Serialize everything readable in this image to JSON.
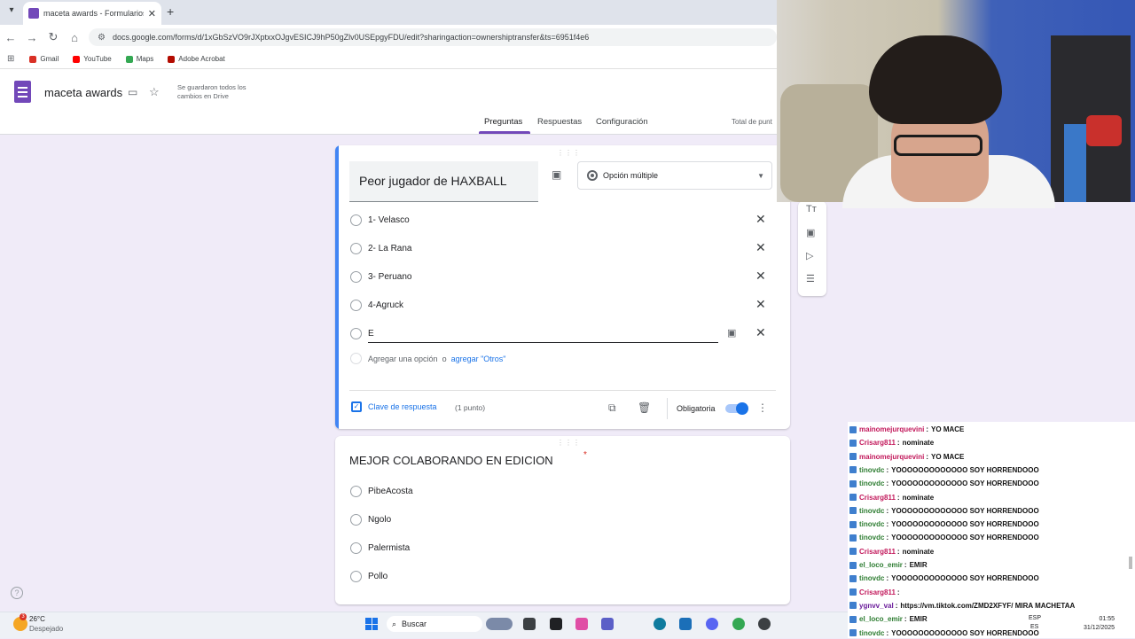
{
  "browser": {
    "tab_title": "maceta awards - Formularios d",
    "tab_close": "✕",
    "new_tab": "+",
    "url": "docs.google.com/forms/d/1xGbSzVO9rJXptxxOJgvESICJ9hP50gZlv0USEpgyFDU/edit?sharingaction=ownershiptransfer&ts=6951f4e6",
    "bookmarks": [
      "Gmail",
      "YouTube",
      "Maps",
      "Adobe Acrobat"
    ]
  },
  "form": {
    "title": "maceta awards",
    "saved_status": "Se guardaron todos los cambios en Drive",
    "tabs": [
      "Preguntas",
      "Respuestas",
      "Configuración"
    ],
    "total_points": "Total de punt"
  },
  "question1": {
    "title": "Peor jugador de HAXBALL",
    "type": "Opción múltiple",
    "options": [
      "1- Velasco",
      "2- La Rana",
      "3- Peruano",
      "4-Agruck",
      "E"
    ],
    "add_option": "Agregar una opción",
    "or": "o",
    "add_other": "agregar \"Otros\"",
    "answer_key": "Clave de respuesta",
    "points": "(1 punto)",
    "required_label": "Obligatoria"
  },
  "question2": {
    "title": "MEJOR COLABORANDO EN EDICION",
    "required_mark": "*",
    "options": [
      "PibeAcosta",
      "Ngolo",
      "Palermista",
      "Pollo"
    ]
  },
  "chat": [
    {
      "user": "mainomejurquevini",
      "text": "YO MACE",
      "color": "#c2185b"
    },
    {
      "user": "Crisarg811",
      "text": "nominate",
      "color": "#c2185b"
    },
    {
      "user": "mainomejurquevini",
      "text": "YO MACE",
      "color": "#c2185b"
    },
    {
      "user": "tinovdc",
      "text": "YOOOOOOOOOOOOO SOY HORRENDOOO",
      "color": "#2e7d32"
    },
    {
      "user": "tinovdc",
      "text": "YOOOOOOOOOOOOO SOY HORRENDOOO",
      "color": "#2e7d32"
    },
    {
      "user": "Crisarg811",
      "text": "nominate",
      "color": "#c2185b"
    },
    {
      "user": "tinovdc",
      "text": "YOOOOOOOOOOOOO SOY HORRENDOOO",
      "color": "#2e7d32"
    },
    {
      "user": "tinovdc",
      "text": "YOOOOOOOOOOOOO SOY HORRENDOOO",
      "color": "#2e7d32"
    },
    {
      "user": "tinovdc",
      "text": "YOOOOOOOOOOOOO SOY HORRENDOOO",
      "color": "#2e7d32"
    },
    {
      "user": "Crisarg811",
      "text": "nominate",
      "color": "#c2185b"
    },
    {
      "user": "el_loco_emir",
      "text": "EMIR",
      "color": "#2e7d32"
    },
    {
      "user": "tinovdc",
      "text": "YOOOOOOOOOOOOO SOY HORRENDOOO",
      "color": "#2e7d32"
    },
    {
      "user": "Crisarg811",
      "text": "",
      "color": "#c2185b"
    },
    {
      "user": "ygnvv_val",
      "text": "https://vm.tiktok.com/ZMD2XFYF/ MIRA MACHETAA",
      "color": "#6a1b9a"
    },
    {
      "user": "el_loco_emir",
      "text": "EMIR",
      "color": "#2e7d32"
    },
    {
      "user": "tinovdc",
      "text": "YOOOOOOOOOOOOO SOY HORRENDOOO",
      "color": "#2e7d32"
    }
  ],
  "taskbar": {
    "temperature": "26°C",
    "weather": "Despejado",
    "weather_badge": "3",
    "search_placeholder": "Buscar",
    "lang": "ESP",
    "lang2": "ES",
    "time": "01:55",
    "date": "31/12/2025"
  },
  "colors": {
    "accent": "#7248b9",
    "active_blue": "#4285f4",
    "link": "#1a73e8"
  }
}
